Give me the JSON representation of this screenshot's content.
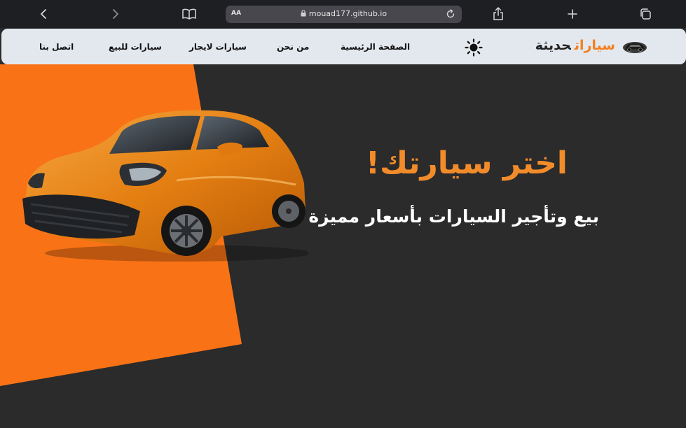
{
  "browser": {
    "text_size_label": "AA",
    "url": "mouad177.github.io",
    "icons": [
      "chevron-left-icon",
      "chevron-right-icon",
      "book-icon",
      "lock-icon",
      "reload-icon",
      "share-icon",
      "plus-icon",
      "tabs-icon"
    ]
  },
  "header": {
    "brand_accent": "سيارات",
    "brand_dark": "حديثة",
    "theme_icon": "sun-icon",
    "nav": [
      "الصفحة الرئيسية",
      "من نحن",
      "سيارات لايجار",
      "سيارات للبيع",
      "اتصل بنا"
    ]
  },
  "hero": {
    "title": "اختر سيارتك!",
    "subtitle": "بيع وتأجير السيارات بأسعار مميزة"
  },
  "colors": {
    "accent": "#f47f1e",
    "background": "#2b2b2b",
    "header_bg": "#e3e8ef",
    "toolbar_bg": "#1e1f22"
  }
}
